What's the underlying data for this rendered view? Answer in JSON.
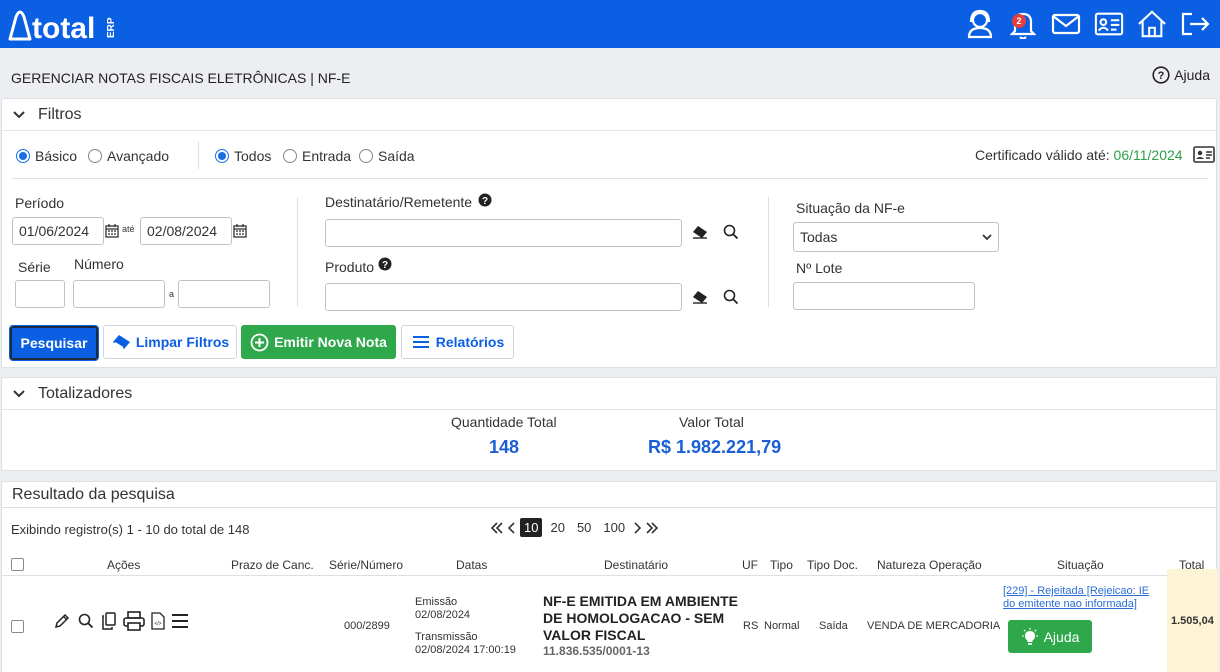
{
  "app": {
    "logo_text": "total",
    "logo_suffix": "ERP",
    "notification_count": "2",
    "page_title": "GERENCIAR NOTAS FISCAIS ELETRÔNICAS | NF-E",
    "help_label": "Ajuda",
    "colors": {
      "brand": "#0a5fe3",
      "green": "#2ea84b",
      "link": "#2a6ed6",
      "cert_date": "#2e9e48"
    }
  },
  "filters": {
    "title": "Filtros",
    "mode_options": [
      "Básico",
      "Avançado"
    ],
    "mode_selected": "Básico",
    "type_options": [
      "Todos",
      "Entrada",
      "Saída"
    ],
    "type_selected": "Todos",
    "certificate_label": "Certificado válido até:",
    "certificate_date": "06/11/2024",
    "period_label": "Período",
    "period_start": "01/06/2024",
    "period_sep": "até",
    "period_end": "02/08/2024",
    "serie_label": "Série",
    "numero_label": "Número",
    "numero_sep": "a",
    "dest_label": "Destinatário/Remetente",
    "produto_label": "Produto",
    "situacao_label": "Situação da NF-e",
    "situacao_value": "Todas",
    "lote_label": "Nº Lote"
  },
  "buttons": {
    "search": "Pesquisar",
    "clear": "Limpar Filtros",
    "new_note": "Emitir Nova Nota",
    "reports": "Relatórios"
  },
  "totals": {
    "title": "Totalizadores",
    "qty_label": "Quantidade Total",
    "qty_value": "148",
    "value_label": "Valor Total",
    "value_value": "R$ 1.982.221,79"
  },
  "results": {
    "title": "Resultado da pesquisa",
    "info": "Exibindo registro(s) 1 - 10 do total de 148",
    "page_sizes": [
      "10",
      "20",
      "50",
      "100"
    ],
    "page_size_selected": "10",
    "columns": [
      "Ações",
      "Prazo de Canc.",
      "Série/Número",
      "Datas",
      "Destinatário",
      "UF",
      "Tipo",
      "Tipo Doc.",
      "Natureza Operação",
      "Situação",
      "Total"
    ],
    "rows": [
      {
        "serie_numero": "000/2899",
        "emissao_label": "Emissão",
        "emissao": "02/08/2024",
        "transmissao_label": "Transmissão",
        "transmissao": "02/08/2024 17:00:19",
        "destinatario": "NF-E EMITIDA EM AMBIENTE DE HOMOLOGACAO - SEM VALOR FISCAL",
        "documento": "11.836.535/0001-13",
        "uf": "RS",
        "tipo": "Normal",
        "tipo_doc": "Saída",
        "natureza": "VENDA DE MERCADORIA",
        "situacao": "[229] - Rejeitada [Rejeicao: IE do emitente nao informada]",
        "situacao_button": "Ajuda",
        "total": "1.505,04"
      }
    ]
  }
}
